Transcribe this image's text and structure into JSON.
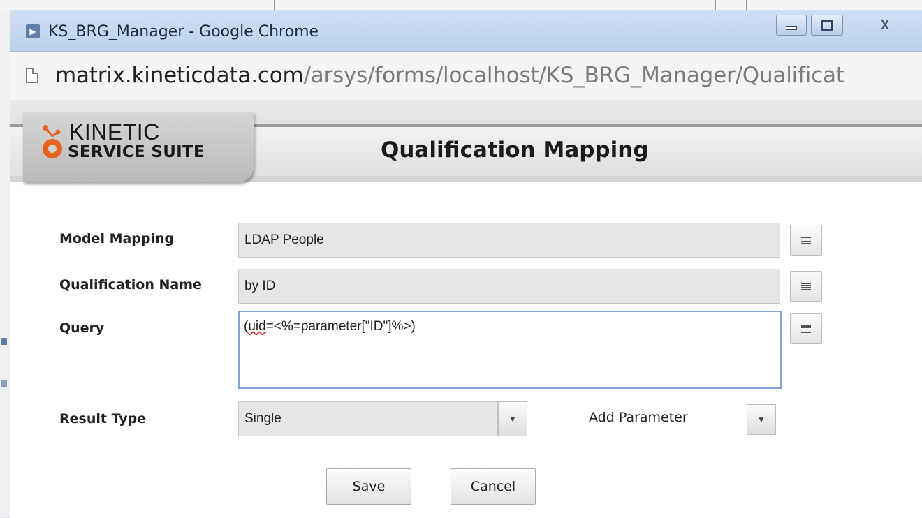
{
  "window": {
    "title": "KS_BRG_Manager - Google Chrome",
    "app_icon": "play-icon",
    "controls": {
      "minimize": "minimize-icon",
      "maximize": "maximize-icon",
      "close_label": "X"
    }
  },
  "address": {
    "url_host": "matrix.kineticdata.com",
    "url_path": "/arsys/forms/localhost/KS_BRG_Manager/Qualificat"
  },
  "header": {
    "logo_line1": "KINETIC",
    "logo_line2": "SERVICE SUITE",
    "form_title": "Qualification Mapping",
    "logo_color": "#e8631c"
  },
  "form": {
    "model_mapping": {
      "label": "Model Mapping",
      "value": "LDAP People"
    },
    "qualification_name": {
      "label": "Qualification Name",
      "value": "by ID"
    },
    "query": {
      "label": "Query",
      "value_prefix": "(",
      "value_misspelled": "uid",
      "value_rest": "=<%=parameter[\"ID\"]%>)"
    },
    "result_type": {
      "label": "Result Type",
      "value": "Single"
    },
    "add_parameter": {
      "label": "Add Parameter"
    },
    "save_label": "Save",
    "cancel_label": "Cancel"
  }
}
